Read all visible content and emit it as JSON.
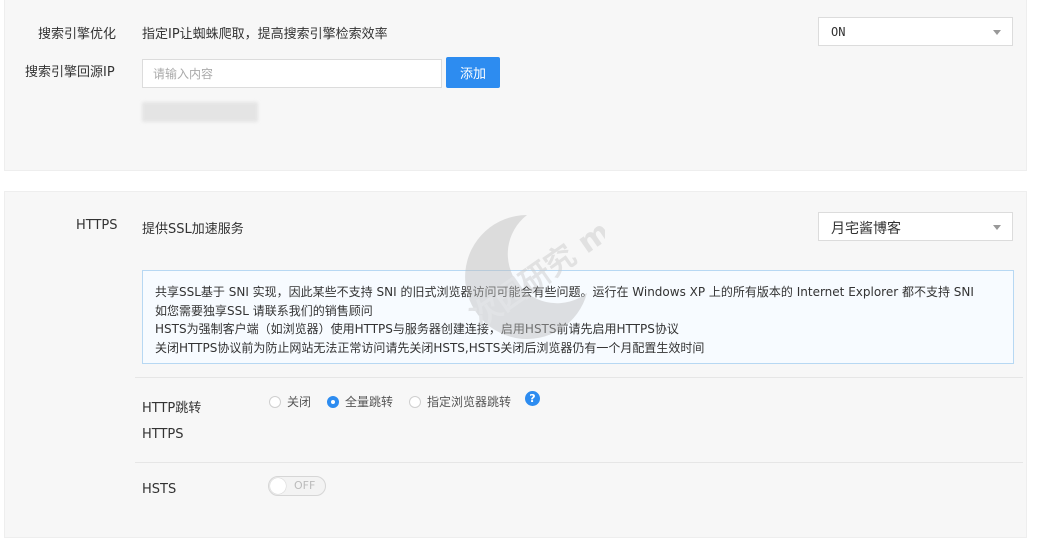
{
  "seo": {
    "label": "搜索引擎优化",
    "description": "指定IP让蜘蛛爬取，提高搜索引擎检索效率",
    "select_value": "ON",
    "source_ip_label": "搜索引擎回源IP",
    "ip_input_placeholder": "请输入内容",
    "add_button": "添加"
  },
  "https": {
    "label": "HTTPS",
    "description": "提供SSL加速服务",
    "select_value": "月宅酱博客",
    "notice_lines": [
      "共享SSL基于 SNI 实现，因此某些不支持 SNI 的旧式浏览器访问可能会有些问题。运行在 Windows XP 上的所有版本的 Internet Explorer 都不支持 SNI",
      "如您需要独享SSL 请联系我们的销售顾问",
      "HSTS为强制客户端（如浏览器）使用HTTPS与服务器创建连接，启用HSTS前请先启用HTTPS协议",
      "关闭HTTPS协议前为防止网站无法正常访问请先关闭HSTS,HSTS关闭后浏览器仍有一个月配置生效时间"
    ],
    "redirect_label_line1": "HTTP跳转",
    "redirect_label_line2": "HTTPS",
    "redirect_options": [
      "关闭",
      "全量跳转",
      "指定浏览器跳转"
    ],
    "redirect_selected": "全量跳转",
    "help_icon": "?",
    "hsts_label": "HSTS",
    "hsts_toggle": "OFF"
  },
  "watermark": {
    "text": "次园研究 moe.com"
  },
  "colors": {
    "accent": "#2d8cf0",
    "panel_bg": "#f7f7f7",
    "notice_bg": "#f7fbff",
    "notice_border": "#b7d8f3"
  }
}
